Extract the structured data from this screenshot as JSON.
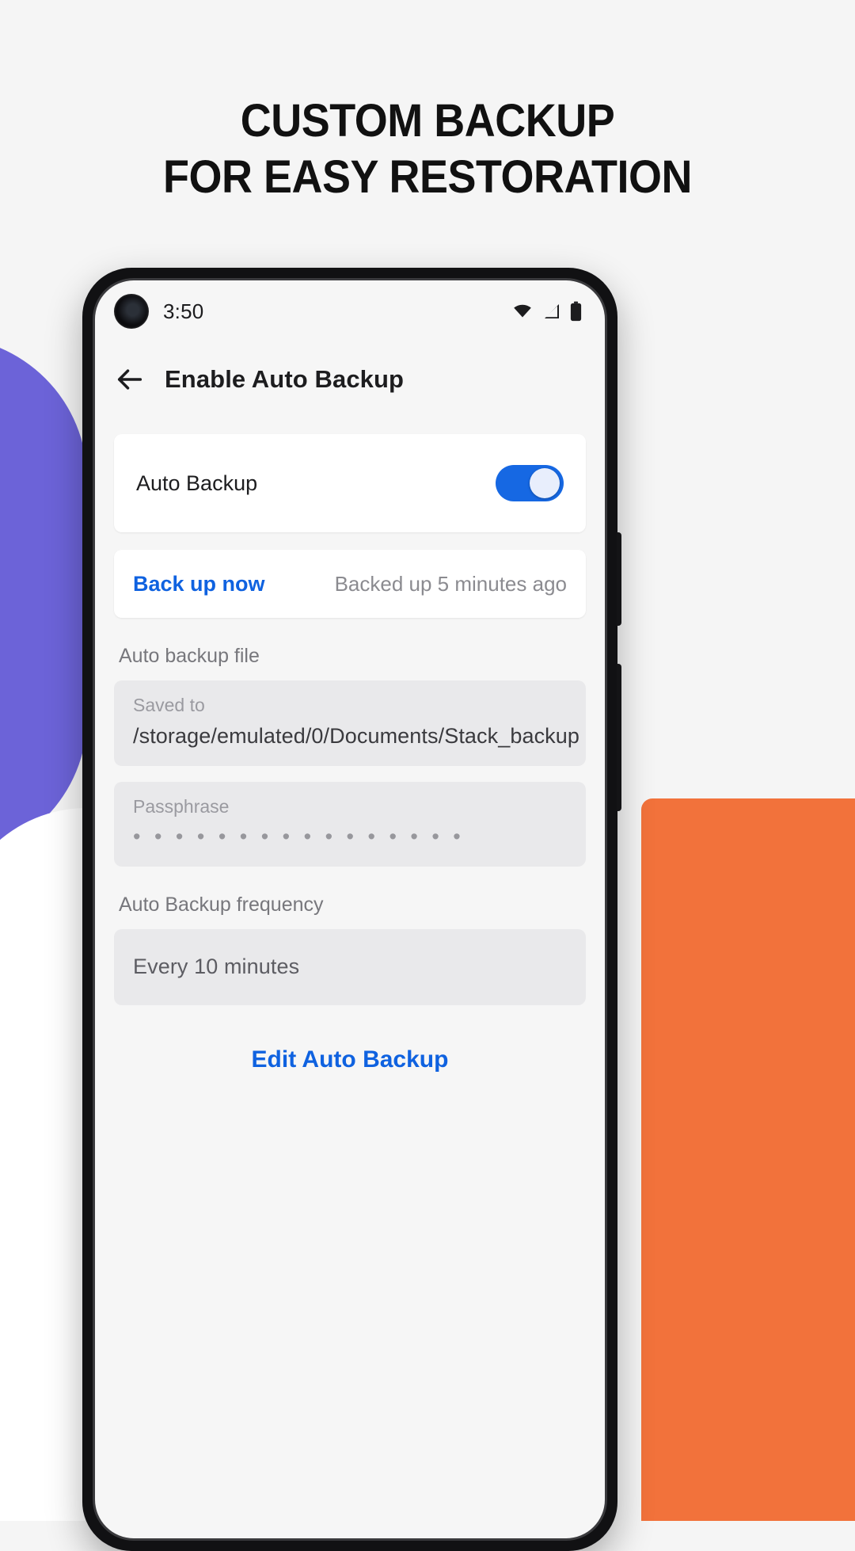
{
  "promo": {
    "headline_line1": "CUSTOM BACKUP",
    "headline_line2": "FOR EASY RESTORATION"
  },
  "colors": {
    "accent_blue": "#0f62e0",
    "toggle_on": "#1668e3",
    "blob_purple": "#6c63d8",
    "blob_orange": "#f2723b",
    "page_background": "#f5f5f5",
    "screen_background": "#f6f6f6"
  },
  "phone": {
    "status_bar": {
      "time": "3:50",
      "icons": [
        "wifi-icon",
        "cellular-signal-icon",
        "battery-icon"
      ]
    },
    "app_bar": {
      "back_icon": "back-arrow-icon",
      "title": "Enable Auto Backup"
    },
    "auto_backup_card": {
      "label": "Auto Backup",
      "toggle_state": "on"
    },
    "backup_now_row": {
      "action_label": "Back up now",
      "status_text": "Backed up 5 minutes ago"
    },
    "auto_backup_file": {
      "section_label": "Auto backup file",
      "saved_to_label": "Saved to",
      "saved_to_value": "/storage/emulated/0/Documents/Stack_backup",
      "passphrase_label": "Passphrase",
      "passphrase_value": "• • • • • • • • • • • • • • • •"
    },
    "frequency": {
      "section_label": "Auto Backup frequency",
      "value": "Every 10 minutes"
    },
    "edit_link": "Edit Auto Backup"
  }
}
